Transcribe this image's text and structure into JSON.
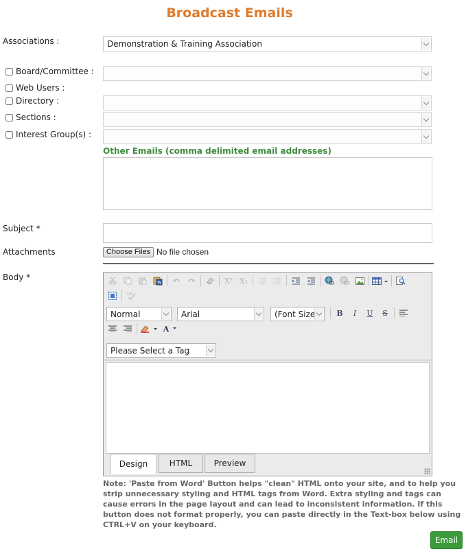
{
  "page": {
    "title": "Broadcast Emails"
  },
  "form": {
    "associations": {
      "label": "Associations :",
      "value": "Demonstration & Training Association"
    },
    "board_committee": {
      "label": "Board/Committee :",
      "checked": false,
      "value": ""
    },
    "web_users": {
      "label": "Web Users :",
      "checked": false
    },
    "directory": {
      "label": "Directory :",
      "checked": false,
      "value": ""
    },
    "sections": {
      "label": "Sections :",
      "checked": false,
      "value": ""
    },
    "interest_groups": {
      "label": "Interest Group(s) :",
      "checked": false,
      "value": ""
    },
    "other_emails": {
      "label": "Other Emails (comma delimited email addresses)",
      "value": ""
    },
    "subject": {
      "label": "Subject *",
      "value": ""
    },
    "attachments": {
      "label": "Attachments",
      "button": "Choose Files",
      "status": "No file chosen"
    },
    "body": {
      "label": "Body *"
    }
  },
  "editor": {
    "format": "Normal",
    "font": "Arial",
    "font_size": "(Font Size)",
    "tag_select": "Please Select a Tag",
    "icons": {
      "cut": "scissors-icon",
      "copy": "copy-icon",
      "paste": "paste-icon",
      "paste_word": "paste-word-icon",
      "undo": "undo-icon",
      "redo": "redo-icon",
      "clean": "eraser-icon",
      "superscript": "superscript-icon",
      "subscript": "subscript-icon",
      "ordered_list": "ordered-list-icon",
      "unordered_list": "unordered-list-icon",
      "indent": "indent-icon",
      "outdent": "outdent-icon",
      "link": "link-icon",
      "unlink": "unlink-icon",
      "image": "image-icon",
      "table": "table-icon",
      "find": "find-icon",
      "select_all": "select-all-icon",
      "spellcheck": "spellcheck-icon",
      "bold": "bold-icon",
      "italic": "italic-icon",
      "underline": "underline-icon",
      "strike": "strikethrough-icon",
      "align_left": "align-left-icon",
      "align_center": "align-center-icon",
      "align_right": "align-right-icon",
      "highlight": "highlight-icon",
      "font_color": "font-color-icon"
    },
    "glyphs": {
      "superscript": "X²",
      "subscript": "X₁",
      "bold": "B",
      "italic": "I",
      "underline": "U",
      "strike": "S",
      "font_color": "A"
    },
    "tabs": [
      {
        "label": "Design"
      },
      {
        "label": "HTML"
      },
      {
        "label": "Preview"
      }
    ]
  },
  "note": "Note: 'Paste from Word' Button helps \"clean\" HTML onto your site, and to help you strip unnecessary styling and HTML tags from Word. Extra styling and tags can cause errors in the page layout and can lead to inconsistent information. If this button does not format properly, you can paste directly in the Text-box below using CTRL+V on your keyboard.",
  "actions": {
    "email": "Email"
  },
  "colors": {
    "title": "#e07b2c",
    "accent_green": "#3d8b3d",
    "button_green": "#3b9b3b"
  }
}
